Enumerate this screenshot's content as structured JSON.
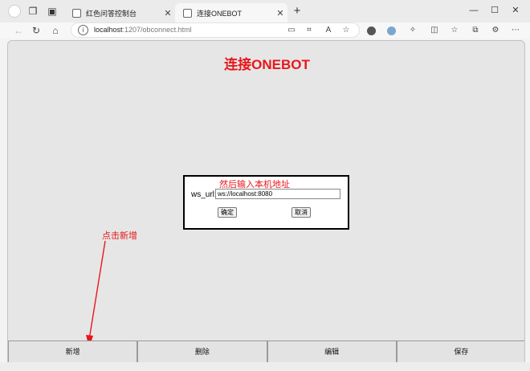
{
  "browser": {
    "tabs": [
      {
        "title": "红色问答控制台",
        "active": false
      },
      {
        "title": "连接ONEBOT",
        "active": true
      }
    ],
    "new_tab_glyph": "+",
    "window_controls": {
      "minimize": "—",
      "maximize": "☐",
      "close": "✕"
    },
    "address": {
      "host": "localhost",
      "rest": ":1207/obconnect.html"
    },
    "icons": [
      "profile-icon",
      "workspaces-icon",
      "tab-actions-icon",
      "back-icon",
      "refresh-icon",
      "home-icon",
      "info-icon",
      "split-screen-icon",
      "translate-icon",
      "read-aloud-icon",
      "favorite-star-icon",
      "extension-icon",
      "collections-icon",
      "favorites-icon",
      "profile-sync-icon"
    ]
  },
  "page": {
    "title": "连接ONEBOT",
    "dialog": {
      "label": "ws_url:",
      "value": "ws://localhost:8080",
      "ok_label": "确定",
      "cancel_label": "取消"
    },
    "annotations": {
      "input_hint": "然后输入本机地址",
      "add_hint": "点击新增"
    },
    "buttons": {
      "add": "新增",
      "delete": "删除",
      "edit": "编辑",
      "save": "保存"
    }
  },
  "colors": {
    "title_red": "#e8161b",
    "annotation_red": "#e8161b",
    "page_background": "#e6e6e6"
  }
}
